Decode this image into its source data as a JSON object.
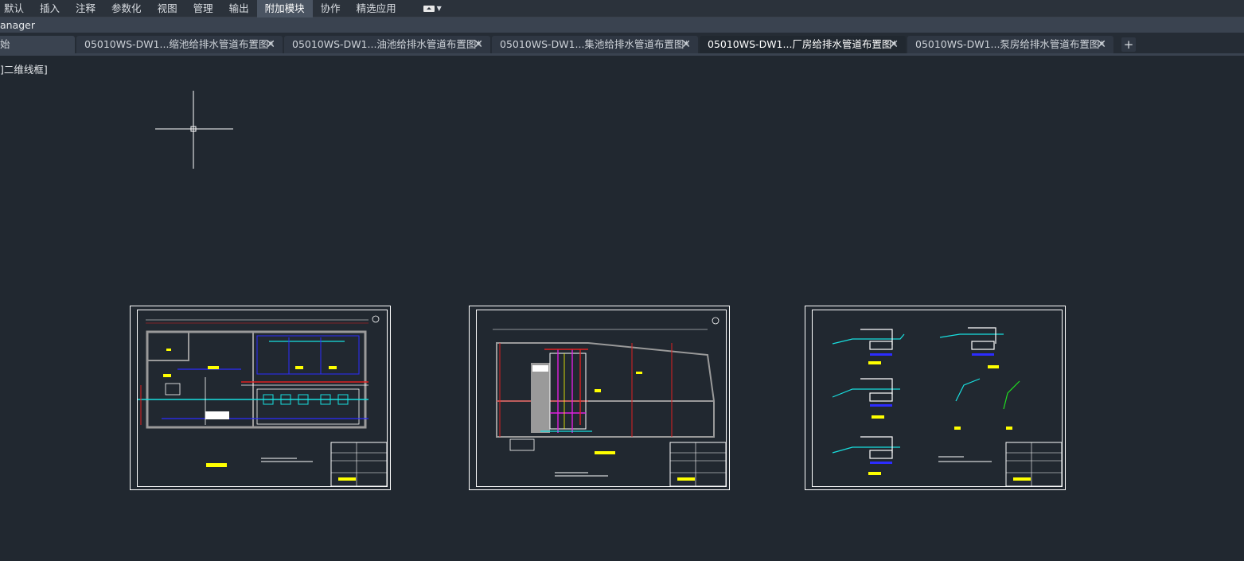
{
  "ribbon": {
    "tabs": [
      "默认",
      "插入",
      "注释",
      "参数化",
      "视图",
      "管理",
      "输出",
      "附加模块",
      "协作",
      "精选应用"
    ],
    "active_tab": "附加模块"
  },
  "manager_bar": {
    "text": "anager"
  },
  "doc_tabs": {
    "first_label": "始",
    "tabs": [
      "05010WS-DW1...缩池给排水管道布置图*",
      "05010WS-DW1...油池给排水管道布置图*",
      "05010WS-DW1...集池给排水管道布置图*",
      "05010WS-DW1...厂房给排水管道布置图*",
      "05010WS-DW1...泵房给排水管道布置图*"
    ],
    "active_index": 3,
    "close_glyph": "✕",
    "add_glyph": "+"
  },
  "viewport": {
    "label": "]二维线框]"
  },
  "colors": {
    "background": "#212830",
    "frame": "#ffffff",
    "red": "#e02020",
    "blue": "#2c2cff",
    "cyan": "#18e0e0",
    "magenta": "#e020e0",
    "yellow": "#ffff00",
    "green": "#20e020",
    "gray": "#9a9a9a"
  }
}
